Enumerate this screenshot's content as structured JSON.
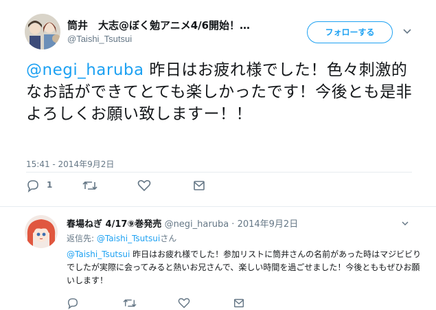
{
  "main_tweet": {
    "display_name": "筒井　大志@ぼく勉アニメ4/6開始！…",
    "handle": "@Taishi_Tsutsui",
    "follow_label": "フォローする",
    "mention": "@negi_haruba",
    "text": " 昨日はお疲れ様でした！色々刺激的なお話ができてとても楽しかったです！今後とも是非よろしくお願い致しますー！！",
    "timestamp": "15:41 - 2014年9月2日",
    "reply_count": "1",
    "icons": [
      "reply-icon",
      "retweet-icon",
      "like-icon",
      "message-icon",
      "chevron-down-icon"
    ]
  },
  "reply_tweet": {
    "display_name": "春場ねぎ 4/17⑨巻発売",
    "handle": "@negi_haruba",
    "separator": " · ",
    "date": "2014年9月2日",
    "replying_to_prefix": "返信先: ",
    "replying_to_handle": "@Taishi_Tsutsui",
    "replying_to_suffix": "さん",
    "mention": "@Taishi_Tsutsui",
    "text": " 昨日はお疲れ様でした！参加リストに筒井さんの名前があった時はマジビビりでしたが実際に会ってみると熱いお兄さんで、楽しい時間を過ごせました！今後とももぜひお願いします！"
  },
  "colors": {
    "accent": "#1da1f2",
    "secondary_text": "#657786",
    "divider": "#e6ecf0"
  }
}
